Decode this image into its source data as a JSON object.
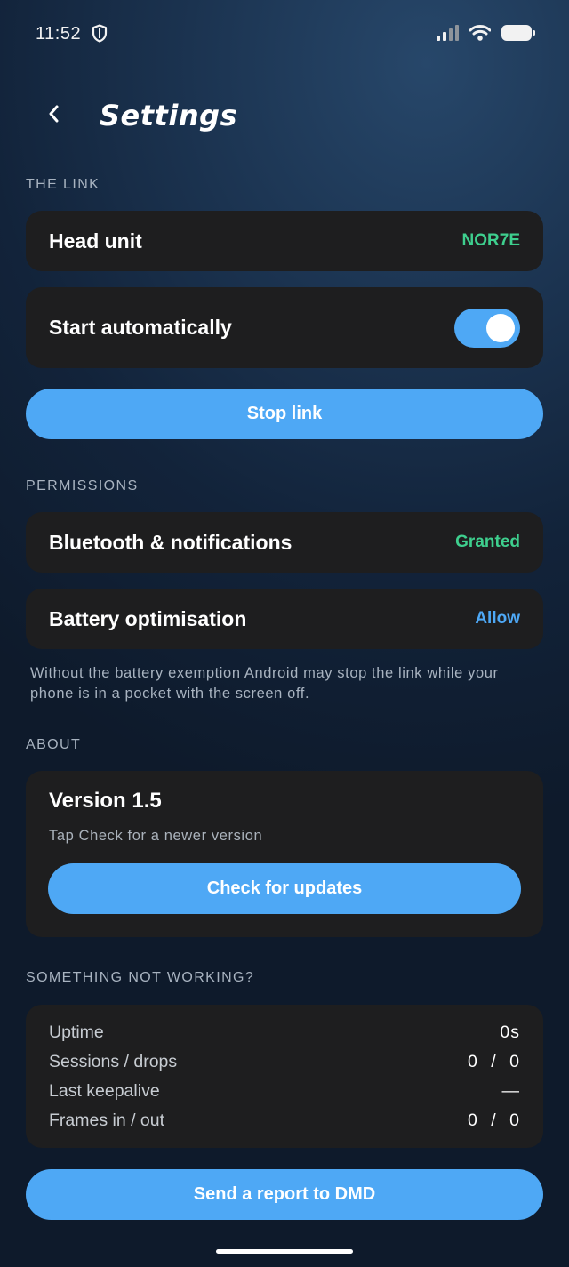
{
  "status_bar": {
    "time": "11:52",
    "icons": [
      "shield-icon",
      "signal-icon",
      "wifi-icon",
      "battery-icon"
    ]
  },
  "header": {
    "back_icon": "chevron-left-icon",
    "title": "Settings"
  },
  "sections": {
    "the_link": {
      "label": "THE LINK",
      "head_unit": {
        "title": "Head unit",
        "value": "NOR7E"
      },
      "start_automatically": {
        "title": "Start automatically",
        "toggle_on": true
      },
      "stop_button": "Stop link"
    },
    "permissions": {
      "label": "PERMISSIONS",
      "bluetooth": {
        "title": "Bluetooth & notifications",
        "value": "Granted"
      },
      "battery": {
        "title": "Battery optimisation",
        "value": "Allow"
      },
      "note": "Without the battery exemption Android may stop the link while your phone is in a pocket with the screen off."
    },
    "about": {
      "label": "ABOUT",
      "version_title": "Version 1.5",
      "version_subtitle": "Tap Check for a newer version",
      "check_button": "Check for updates"
    },
    "diagnostics": {
      "label": "SOMETHING NOT WORKING?",
      "rows": [
        {
          "label": "Uptime",
          "value": "0s"
        },
        {
          "label": "Sessions / drops",
          "value": "0 / 0"
        },
        {
          "label": "Last keepalive",
          "value": "—"
        },
        {
          "label": "Frames in / out",
          "value": "0 / 0"
        }
      ],
      "report_button": "Send a report to DMD"
    }
  },
  "colors": {
    "accent_blue": "#4ea8f5",
    "status_green": "#3ecf8e",
    "card_bg": "#1e1e1f"
  }
}
